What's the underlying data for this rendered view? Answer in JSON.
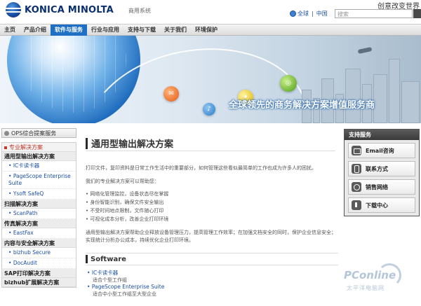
{
  "header": {
    "brand": "KONICA MINOLTA",
    "site_name": "商用系统",
    "slogan": "创意改变世界",
    "lang_global": "全球",
    "lang_china": "中国",
    "search_placeholder": "搜索"
  },
  "nav": {
    "items": [
      "主页",
      "产品介绍",
      "软件与服务",
      "行业与应用",
      "支持与下载",
      "关于我们",
      "环境保护"
    ],
    "active_index": 2
  },
  "banner": {
    "headline": "全球领先的商务解决方案增值服务商"
  },
  "sidebar": {
    "ops_button": "OPS综合提案服务",
    "section_head": "专业解决方案",
    "groups": [
      {
        "category": "通用型输出解决方案",
        "links": [
          "IC卡读卡器",
          "PageScope Enterprise Suite",
          "Ysoft SafeQ"
        ]
      },
      {
        "category": "扫描解决方案",
        "links": [
          "ScanPath"
        ]
      },
      {
        "category": "传真解决方案",
        "links": [
          "EastFax"
        ]
      },
      {
        "category": "内容与安全解决方案",
        "links": [
          "bizhub Secure",
          "DocAudit"
        ]
      },
      {
        "category": "SAP打印解决方案",
        "links": []
      },
      {
        "category": "bizhub扩展解决方案",
        "links": []
      }
    ]
  },
  "main": {
    "title": "通用型输出解决方案",
    "intro": "打印文件，复印资料是日常工作生活中的重要部分，如何管理这些看似最简单的工作也成为许多人的困扰。",
    "help_line": "我们的专业解决方案可以帮助您：",
    "bullets": [
      "网络化管理监控，设备状态尽在掌握",
      "身份智能识别，确保文件安全输出",
      "不受时间地点限制，文件随心打印",
      "可视化成本分析，改善企业打印环境"
    ],
    "summary": "通用型输出解决方案帮助企业释放设备管理压力，提高管理工作效率；在加强文档安全的同时，保护企业信息安全；实现统计分析办公成本，持续优化企业打印环境。",
    "software_heading": "Software",
    "software": [
      {
        "name": "IC卡读卡器",
        "desc": "适合个型工作组"
      },
      {
        "name": "PageScope Enterprise Suite",
        "desc": "适合中小型工作组至大型企业"
      }
    ]
  },
  "support": {
    "heading": "支持服务",
    "items": [
      {
        "label": "Email咨询",
        "icon": "mail-icon"
      },
      {
        "label": "联系方式",
        "icon": "phone-icon"
      },
      {
        "label": "销售网络",
        "icon": "map-icon"
      },
      {
        "label": "下载中心",
        "icon": "download-icon"
      }
    ]
  },
  "watermark": {
    "main": "PConline",
    "sub": "太平洋电脑网"
  },
  "colors": {
    "accent": "#1f6fc5",
    "link": "#1a4fa3",
    "section_red": "#c0392b"
  }
}
